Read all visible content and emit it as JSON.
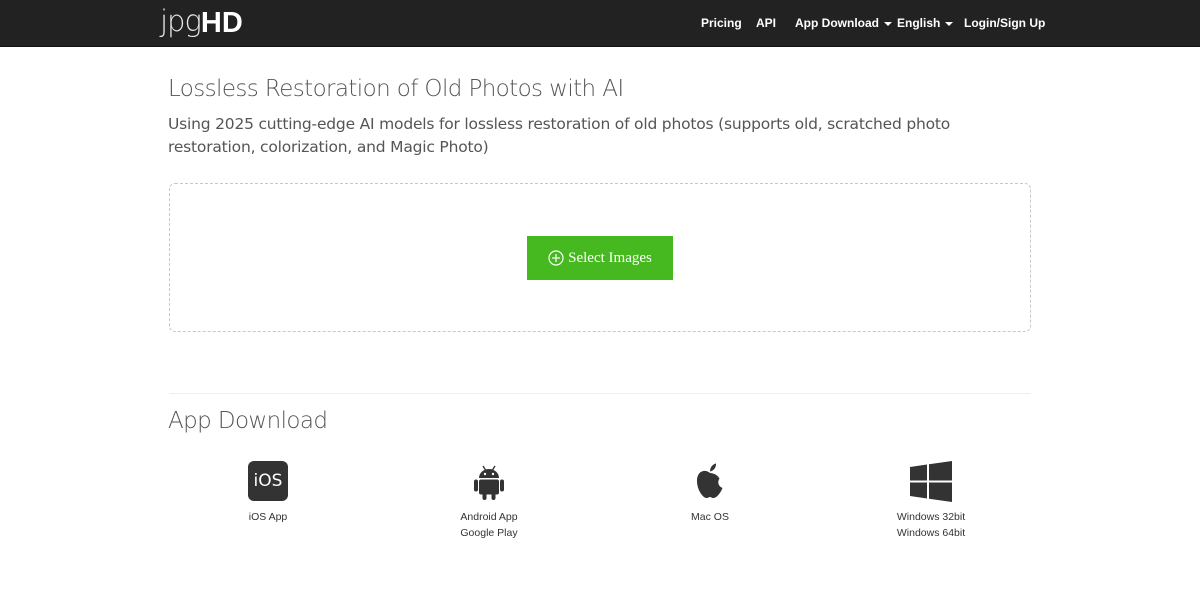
{
  "header": {
    "logo_light": "jpg",
    "logo_bold": "HD",
    "nav": [
      {
        "label": "Pricing"
      },
      {
        "label": "API"
      },
      {
        "label": "App Download"
      },
      {
        "label": "English"
      },
      {
        "label": "Login/Sign Up"
      }
    ]
  },
  "main": {
    "title": "Lossless Restoration of Old Photos with AI",
    "description": "Using 2025 cutting-edge AI models for lossless restoration of old photos (supports old, scratched photo restoration, colorization, and Magic Photo)",
    "select_button": "Select Images"
  },
  "app_download": {
    "title": "App Download",
    "apps": [
      {
        "icon": "ios-icon",
        "icon_text": "iOS",
        "label": "iOS App"
      },
      {
        "icon": "android-icon",
        "label": "Android App",
        "label2": "Google Play"
      },
      {
        "icon": "apple-icon",
        "label": "Mac OS"
      },
      {
        "icon": "windows-icon",
        "label": "Windows 32bit",
        "label2": "Windows 64bit"
      }
    ]
  },
  "colors": {
    "navbar": "#222222",
    "accent_green": "#46b921",
    "text": "#555555"
  }
}
